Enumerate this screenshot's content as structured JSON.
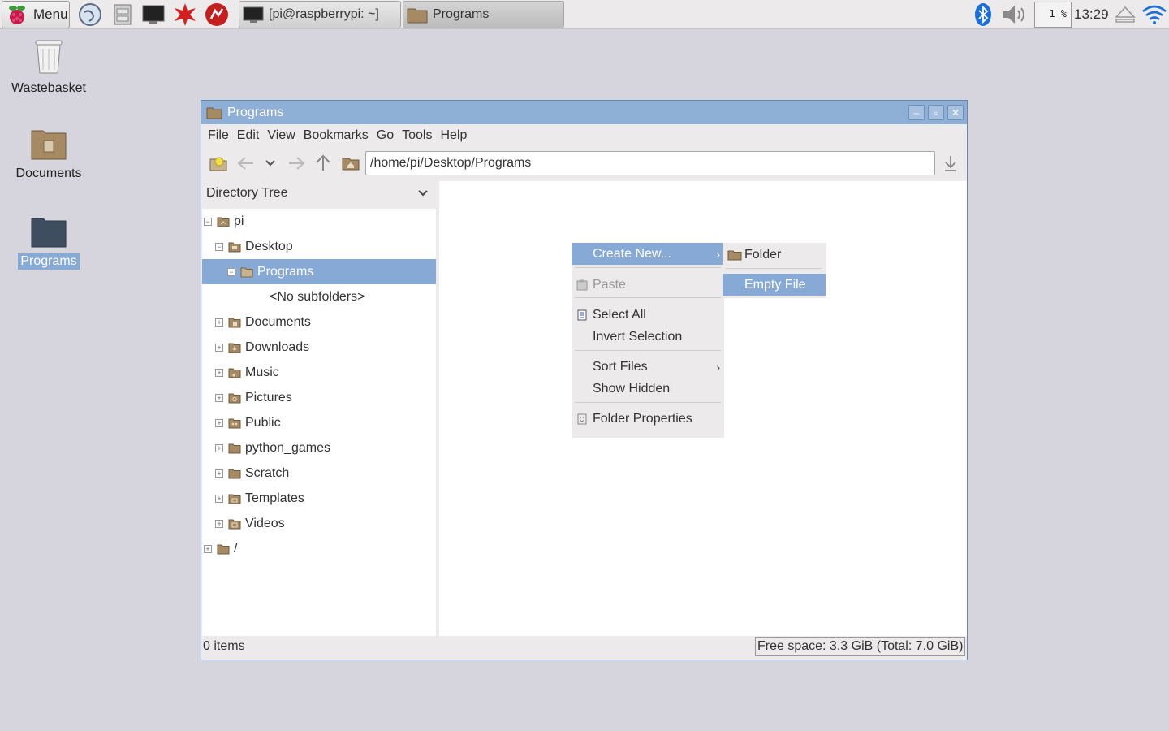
{
  "taskbar": {
    "menu_label": "Menu",
    "tasks": [
      {
        "label": "[pi@raspberrypi: ~]",
        "icon": "terminal-icon"
      },
      {
        "label": "Programs",
        "icon": "folder-icon"
      }
    ],
    "cpu_label": "1 %",
    "clock": "13:29"
  },
  "desktop": {
    "icons": [
      {
        "label": "Wastebasket"
      },
      {
        "label": "Documents"
      },
      {
        "label": "Programs"
      }
    ]
  },
  "window": {
    "title": "Programs",
    "menu": [
      "File",
      "Edit",
      "View",
      "Bookmarks",
      "Go",
      "Tools",
      "Help"
    ],
    "path": "/home/pi/Desktop/Programs",
    "side_pane_mode": "Directory Tree",
    "tree": [
      {
        "label": "pi",
        "expander": "−"
      },
      {
        "label": "Desktop",
        "expander": "−"
      },
      {
        "label": "Programs",
        "expander": "−"
      },
      {
        "label": "<No subfolders>"
      },
      {
        "label": "Documents",
        "expander": "+"
      },
      {
        "label": "Downloads",
        "expander": "+"
      },
      {
        "label": "Music",
        "expander": "+"
      },
      {
        "label": "Pictures",
        "expander": "+"
      },
      {
        "label": "Public",
        "expander": "+"
      },
      {
        "label": "python_games",
        "expander": "+"
      },
      {
        "label": "Scratch",
        "expander": "+"
      },
      {
        "label": "Templates",
        "expander": "+"
      },
      {
        "label": "Videos",
        "expander": "+"
      },
      {
        "label": "/",
        "expander": "+"
      }
    ],
    "status_items": "0 items",
    "status_space": "Free space: 3.3 GiB (Total: 7.0 GiB)"
  },
  "context_menu": {
    "create_new": "Create New...",
    "paste": "Paste",
    "select_all": "Select All",
    "invert_selection": "Invert Selection",
    "sort_files": "Sort Files",
    "show_hidden": "Show Hidden",
    "folder_properties": "Folder Properties"
  },
  "submenu": {
    "folder": "Folder",
    "empty_file": "Empty File"
  },
  "colors": {
    "accent": "#87a9d6",
    "titlebar": "#8fb0d6",
    "desktop": "#d6d5dd"
  }
}
